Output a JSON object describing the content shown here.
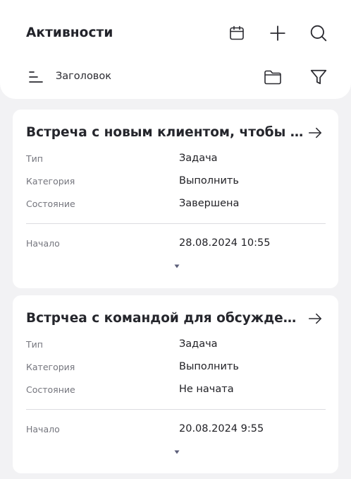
{
  "header": {
    "title": "Активности",
    "icons": [
      "calendar-icon",
      "plus-icon",
      "search-icon",
      "sort-icon",
      "folder-icon",
      "filter-icon"
    ],
    "sort_label": "Заголовок"
  },
  "labels": {
    "type": "Тип",
    "category": "Категория",
    "state": "Состояние",
    "start": "Начало"
  },
  "cards": [
    {
      "title": "Встреча с новым клиентом, чтобы пре...",
      "type": "Задача",
      "category": "Выполнить",
      "state": "Завершена",
      "start": "28.08.2024 10:55"
    },
    {
      "title": "Встрчеа с командой для обсуждения п...",
      "type": "Задача",
      "category": "Выполнить",
      "state": "Не начата",
      "start": "20.08.2024 9:55"
    }
  ],
  "colors": {
    "background": "#f2f2f4",
    "surface": "#ffffff",
    "text": "#1f1f24",
    "muted": "#74757d",
    "expand_arrow": "#5b5e78"
  }
}
